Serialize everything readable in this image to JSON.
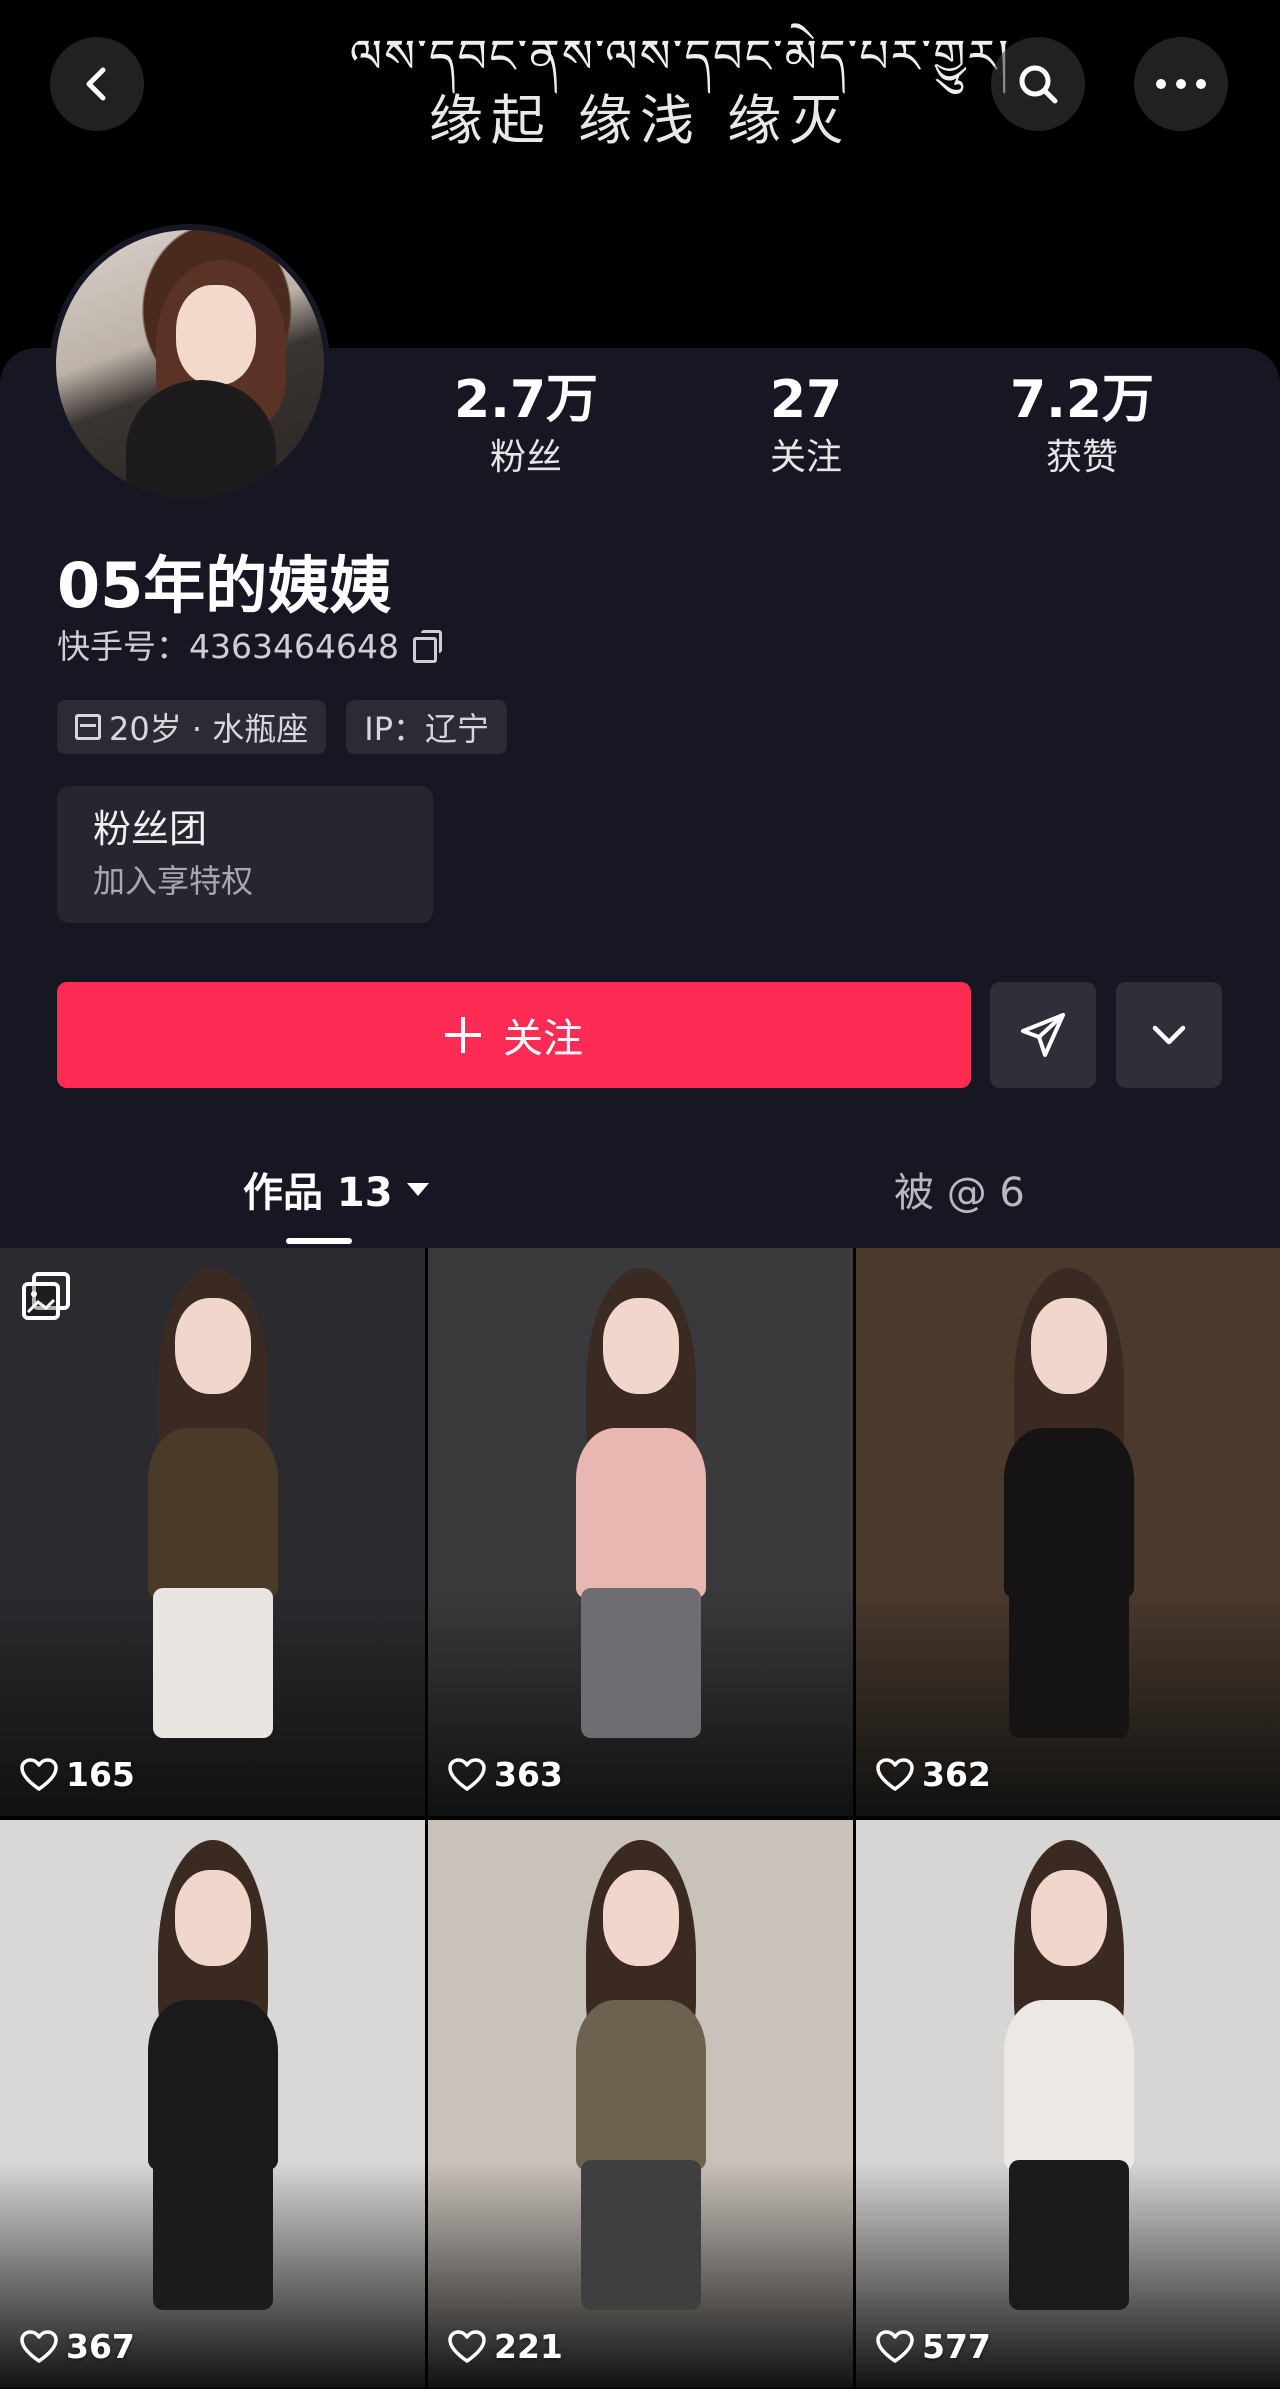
{
  "banner": {
    "tibetan_text": "ལས་དབང་ནས་ལས་དབང་མེད་པར་གྱུར།",
    "chinese_text": "缘起 缘浅 缘灭"
  },
  "header": {
    "back_icon": "chevron-left-icon",
    "search_icon": "search-icon",
    "more_icon": "more-horizontal-icon"
  },
  "profile": {
    "stats": [
      {
        "value": "2.7万",
        "label": "粉丝"
      },
      {
        "value": "27",
        "label": "关注"
      },
      {
        "value": "7.2万",
        "label": "获赞"
      }
    ],
    "name": "05年的姨姨",
    "kwai_id": "快手号：4363464648",
    "tags": {
      "age": "20岁 · 水瓶座",
      "ip": "IP：辽宁"
    },
    "fans_club": {
      "title": "粉丝团",
      "subtitle": "加入享特权"
    },
    "follow_label": "关注",
    "accent_color": "#fe2c55"
  },
  "tabs": [
    {
      "label": "作品 13",
      "active": true
    },
    {
      "label": "被 @ 6",
      "active": false
    }
  ],
  "grid": [
    {
      "likes": "165",
      "album": true,
      "bg": "#2b2a2e",
      "outfit": "#e9e6e2",
      "top": "#4a3a2a"
    },
    {
      "likes": "363",
      "album": false,
      "bg": "#3a3a3d",
      "outfit": "#6e6e72",
      "top": "#e8b7b1"
    },
    {
      "likes": "362",
      "album": false,
      "bg": "#4a3a2c",
      "outfit": "#151313",
      "top": "#151313"
    },
    {
      "likes": "367",
      "album": false,
      "bg": "#d9d8d6",
      "outfit": "#1c1c1d",
      "top": "#1a1a1a"
    },
    {
      "likes": "221",
      "album": false,
      "bg": "#c9c2ba",
      "outfit": "#3f3f42",
      "top": "#6d6250"
    },
    {
      "likes": "577",
      "album": false,
      "bg": "#d7d6d4",
      "outfit": "#1b1b1c",
      "top": "#ece8e3"
    }
  ]
}
